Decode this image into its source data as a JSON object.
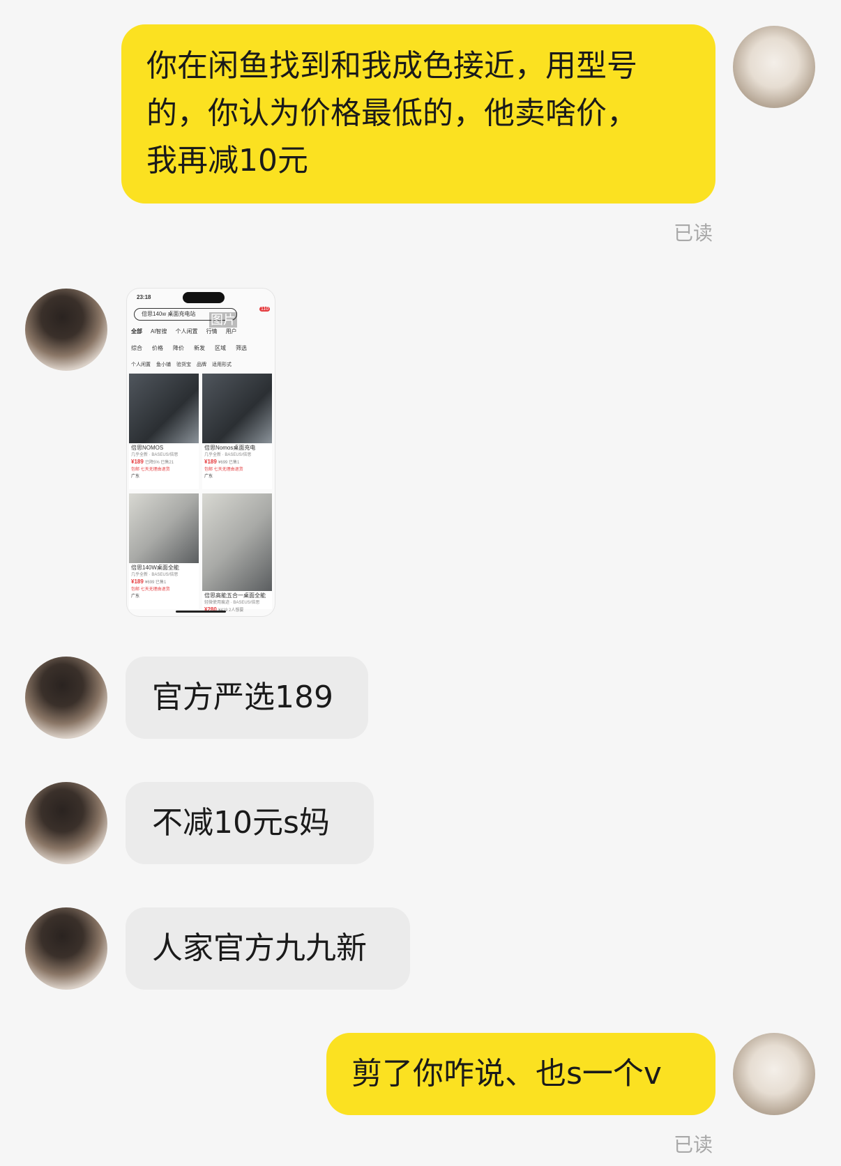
{
  "messages": [
    {
      "sender": "me",
      "type": "text",
      "text": "你在闲鱼找到和我成色接近，用型号的，你认为价格最低的，他卖啥价，我再减10元",
      "lines": [
        "你在闲鱼找到和我成色接近，用型号",
        "的，你认为价格最低的，他卖啥价，",
        "我再减10元"
      ],
      "status": "已读"
    },
    {
      "sender": "them",
      "type": "image",
      "image_label": "图片"
    },
    {
      "sender": "them",
      "type": "text",
      "text": "官方严选189"
    },
    {
      "sender": "them",
      "type": "text",
      "text": "不减10元s妈"
    },
    {
      "sender": "them",
      "type": "text",
      "text": "人家官方九九新"
    },
    {
      "sender": "me",
      "type": "text",
      "text": "剪了你咋说、也s一个v",
      "status": "已读"
    }
  ],
  "thumbnail": {
    "time": "23:18",
    "search_text": "倍思140w 桌面充电站",
    "badge": "110",
    "tabs": [
      "全部",
      "AI智搜",
      "个人闲置",
      "行情",
      "用户"
    ],
    "filters": [
      "综合",
      "价格",
      "降价",
      "新发",
      "区域",
      "筛选"
    ],
    "chips": [
      "个人闲置",
      "鱼小铺",
      "验货宝",
      "品牌",
      "适用形式"
    ],
    "items": [
      {
        "title": "倍思NOMOS",
        "condition": "几乎全新 · BASEUS/倍思",
        "price": "¥189",
        "extra": "已降5% 已售21",
        "tag": "包邮 七天无理由退货",
        "loc": "广东"
      },
      {
        "title": "倍思Nomos桌面充电",
        "condition": "几乎全新 · BASEUS/倍思",
        "price": "¥189",
        "extra": "¥699 已售1",
        "tag": "包邮 七天无理由退货",
        "loc": "广东"
      },
      {
        "title": "倍思140W桌面全能",
        "condition": "几乎全新 · BASEUS/倍思",
        "price": "¥189",
        "extra": "¥699 已售1",
        "tag": "包邮 七天无理由退货",
        "loc": "广东"
      },
      {
        "title": "倍思高能五合一桌面全能",
        "condition": "轻微使用痕迹 · BASEUS/倍思",
        "price": "¥280",
        "extra": "¥419 2人想要",
        "tag": "",
        "loc": ""
      }
    ]
  },
  "colors": {
    "background": "#f6f6f6",
    "my_bubble": "#fbe121",
    "their_bubble": "#ebebeb",
    "read_status": "#a8a8a8"
  }
}
